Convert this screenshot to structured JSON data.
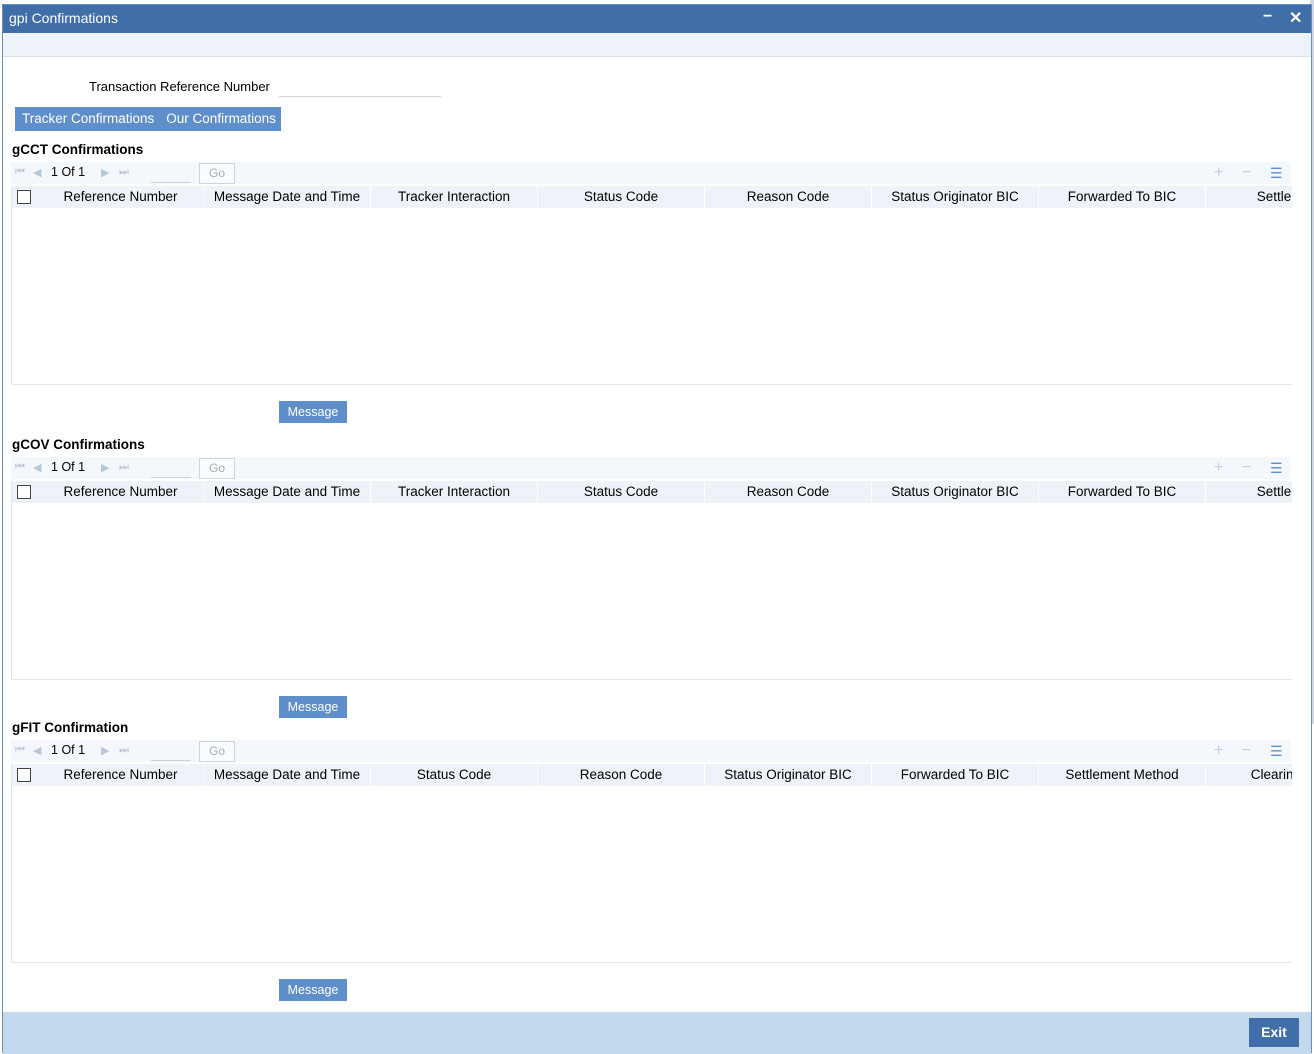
{
  "window": {
    "title": "gpi Confirmations",
    "minimize_icon": "minimize-icon",
    "close_icon": "close-icon"
  },
  "form": {
    "txn_ref_label": "Transaction Reference Number",
    "txn_ref_value": ""
  },
  "tabs": [
    {
      "label": "Tracker Confirmations"
    },
    {
      "label": "Our Confirmations"
    }
  ],
  "sections": [
    {
      "title": "gCCT Confirmations",
      "pager": {
        "current": "1",
        "of_label": "Of",
        "total": "1",
        "go_label": "Go"
      },
      "columns": [
        "Reference Number",
        "Message Date and Time",
        "Tracker Interaction",
        "Status Code",
        "Reason Code",
        "Status Originator BIC",
        "Forwarded To BIC",
        "Settlement"
      ],
      "rows": [],
      "button_label": "Message"
    },
    {
      "title": "gCOV Confirmations",
      "pager": {
        "current": "1",
        "of_label": "Of",
        "total": "1",
        "go_label": "Go"
      },
      "columns": [
        "Reference Number",
        "Message Date and Time",
        "Tracker Interaction",
        "Status Code",
        "Reason Code",
        "Status Originator BIC",
        "Forwarded To BIC",
        "Settlement"
      ],
      "rows": [],
      "button_label": "Message"
    },
    {
      "title": "gFIT Confirmation",
      "pager": {
        "current": "1",
        "of_label": "Of",
        "total": "1",
        "go_label": "Go"
      },
      "columns": [
        "Reference Number",
        "Message Date and Time",
        "Status Code",
        "Reason Code",
        "Status Originator BIC",
        "Forwarded To BIC",
        "Settlement Method",
        "Clearing Sys"
      ],
      "rows": [],
      "button_label": "Message"
    }
  ],
  "footer": {
    "exit_label": "Exit"
  },
  "colors": {
    "titlebar": "#3f6ea8",
    "accent": "#5f8fcb",
    "footer": "#c2d9ee"
  }
}
